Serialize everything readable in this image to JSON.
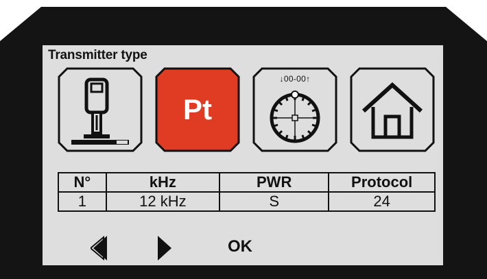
{
  "header": {
    "title": "Transmitter type"
  },
  "tiles": [
    {
      "name": "walkover-receiver",
      "icon": "walkover-receiver-icon",
      "selected": false
    },
    {
      "name": "pt-transmitter",
      "label": "Pt",
      "icon": "pt-icon",
      "selected": true,
      "color": "#e03c24"
    },
    {
      "name": "pitch-dial",
      "scale_label": "↓00-00↑",
      "icon": "pitch-dial-icon",
      "selected": false
    },
    {
      "name": "home",
      "icon": "home-icon",
      "selected": false
    }
  ],
  "table": {
    "headers": [
      "N°",
      "kHz",
      "PWR",
      "Protocol"
    ],
    "rows": [
      [
        "1",
        "12 kHz",
        "S",
        "24"
      ]
    ]
  },
  "footer": {
    "prev_icon": "double-chevron-left-icon",
    "next_icon": "play-right-icon",
    "ok_label": "OK"
  },
  "colors": {
    "bezel": "#141414",
    "screen": "#dedede",
    "selected_tile": "#e03c24"
  }
}
